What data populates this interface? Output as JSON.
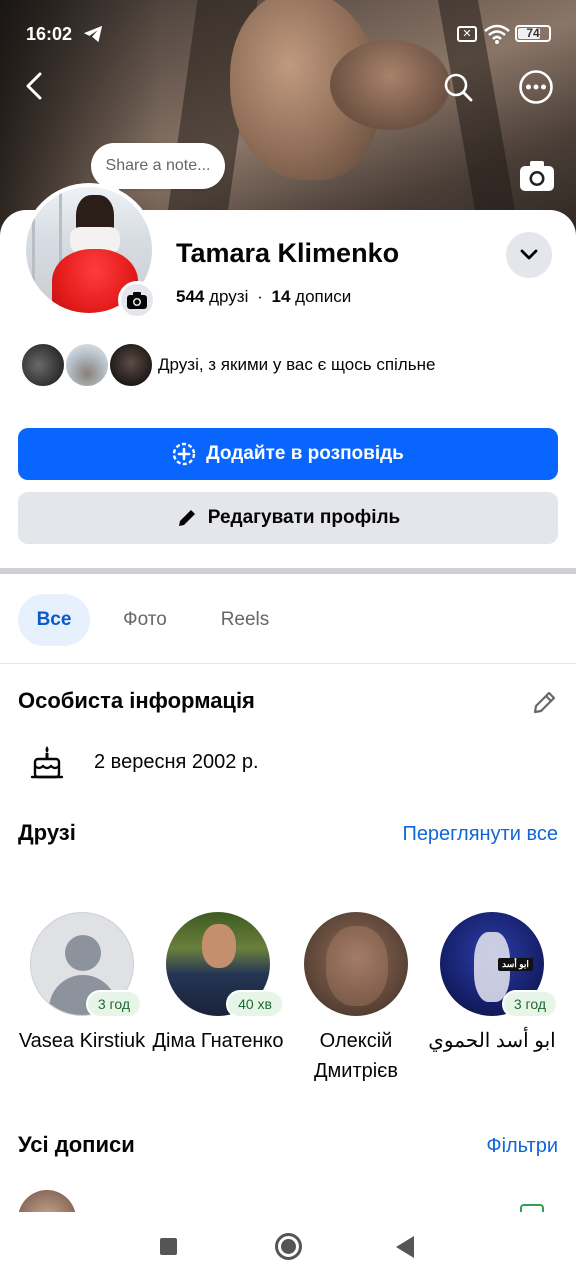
{
  "status_bar": {
    "time": "16:02",
    "battery": "74",
    "battery_level": 0.74
  },
  "header": {
    "back_icon": "chevron-left-icon",
    "search_icon": "search-icon",
    "more_icon": "more-dots-icon",
    "cover_camera_icon": "camera-icon"
  },
  "note": {
    "placeholder": "Share a note..."
  },
  "profile": {
    "name": "Tamara Klimenko",
    "friends_count": "544",
    "friends_label": "друзі",
    "separator": "·",
    "posts_count": "14",
    "posts_label": "дописи",
    "mutual_text": "Друзі, з якими у вас є щось спільне"
  },
  "actions": {
    "add_story": "Додайте в розповідь",
    "edit_profile": "Редагувати профіль"
  },
  "tabs": [
    {
      "label": "Все",
      "active": true
    },
    {
      "label": "Фото",
      "active": false
    },
    {
      "label": "Reels",
      "active": false
    }
  ],
  "personal_info": {
    "title": "Особиста інформація",
    "birthday": "2 вересня 2002 р."
  },
  "friends_section": {
    "title": "Друзі",
    "see_all": "Переглянути все",
    "items": [
      {
        "name": "Vasea Kirstiuk",
        "time": "3 год"
      },
      {
        "name": "Діма Гнатенко",
        "time": "40 хв"
      },
      {
        "name": "Олексій Дмитрієв",
        "time": ""
      },
      {
        "name": "ابو أسد الحموي",
        "time": "3 год"
      }
    ],
    "badge_text": "ابو أسد"
  },
  "posts_section": {
    "title": "Усі дописи",
    "filters": "Фільтри"
  },
  "colors": {
    "primary": "#0866ff",
    "link": "#1067d6",
    "tab_active_bg": "#e7f0fd"
  }
}
